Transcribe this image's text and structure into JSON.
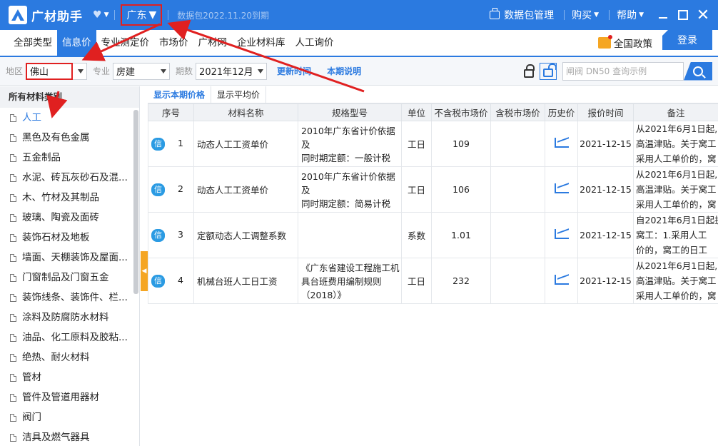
{
  "app": {
    "title": "广材助手",
    "region": "广东",
    "expire_text": "数据包2022.11.20到期",
    "data_pkg_label": "数据包管理",
    "buy_label": "购买",
    "help_label": "帮助"
  },
  "menu": {
    "items": [
      "全部类型",
      "信息价",
      "专业测定价",
      "市场价",
      "广材网",
      "企业材料库",
      "人工询价"
    ],
    "active_index": 1,
    "policy_label": "全国政策",
    "login_label": "登录"
  },
  "filter": {
    "area_label": "地区",
    "area_value": "佛山",
    "major_label": "专业",
    "major_value": "房建",
    "period_label": "期数",
    "period_value": "2021年12月",
    "update_time_label": "更新时间",
    "period_note_label": "本期说明",
    "search_placeholder": "闸阀 DN50 查询示例"
  },
  "sidebar": {
    "header": "所有材料类别",
    "items": [
      "人工",
      "黑色及有色金属",
      "五金制品",
      "水泥、砖瓦灰砂石及混...",
      "木、竹材及其制品",
      "玻璃、陶瓷及面砖",
      "装饰石材及地板",
      "墙面、天棚装饰及屋面...",
      "门窗制品及门窗五金",
      "装饰线条、装饰件、栏...",
      "涂料及防腐防水材料",
      "油品、化工原料及胶粘...",
      "绝热、耐火材料",
      "管材",
      "管件及管道用器材",
      "阀门",
      "洁具及燃气器具"
    ],
    "active_index": 0
  },
  "main": {
    "subtabs": [
      "显示本期价格",
      "显示平均价"
    ],
    "columns": [
      "序号",
      "材料名称",
      "规格型号",
      "单位",
      "不含税市场价",
      "含税市场价",
      "历史价",
      "报价时间",
      "备注"
    ],
    "badge": "信",
    "rows": [
      {
        "no": "1",
        "name": "动态人工工资单价",
        "spec": [
          "2010年广东省计价依据及",
          "同时期定额：一般计税"
        ],
        "unit": "工日",
        "price_ex": "109",
        "price_inc": "",
        "time": "2021-12-15",
        "note": [
          "从2021年6月1日起,",
          "高温津贴。关于窝工",
          "采用人工单价的，窝"
        ]
      },
      {
        "no": "2",
        "name": "动态人工工资单价",
        "spec": [
          "2010年广东省计价依据及",
          "同时期定额：简易计税"
        ],
        "unit": "工日",
        "price_ex": "106",
        "price_inc": "",
        "time": "2021-12-15",
        "note": [
          "从2021年6月1日起,",
          "高温津贴。关于窝工",
          "采用人工单价的，窝"
        ]
      },
      {
        "no": "3",
        "name": "定额动态人工调整系数",
        "spec": [],
        "unit": "系数",
        "price_ex": "1.01",
        "price_inc": "",
        "time": "2021-12-15",
        "note": [
          "自2021年6月1日起执",
          "窝工：1.采用人工",
          "价的，窝工的日工"
        ]
      },
      {
        "no": "4",
        "name": "机械台班人工日工资",
        "spec": [
          "《广东省建设工程施工机",
          "具台班费用编制规则",
          "（2018）》"
        ],
        "unit": "工日",
        "price_ex": "232",
        "price_inc": "",
        "time": "2021-12-15",
        "note": [
          "从2021年6月1日起,",
          "高温津贴。关于窝工",
          "采用人工单价的，窝"
        ]
      }
    ]
  },
  "colors": {
    "brand": "#2b7ae0",
    "annotation": "#e02020",
    "collapse": "#f5a623"
  }
}
